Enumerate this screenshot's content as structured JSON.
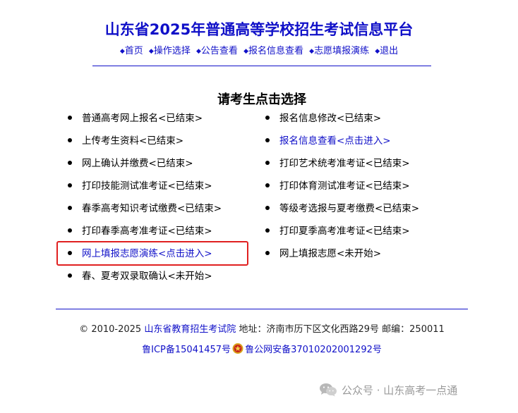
{
  "header": {
    "title": "山东省2025年普通高等学校招生考试信息平台",
    "nav": [
      {
        "label": "首页"
      },
      {
        "label": "操作选择"
      },
      {
        "label": "公告查看"
      },
      {
        "label": "报名信息查看"
      },
      {
        "label": "志愿填报演练"
      },
      {
        "label": "退出"
      }
    ]
  },
  "main": {
    "title": "请考生点击选择",
    "left_options": [
      {
        "label": "普通高考网上报名<已结束>"
      },
      {
        "label": "上传考生资料<已结束>"
      },
      {
        "label": "网上确认并缴费<已结束>"
      },
      {
        "label": "打印技能测试准考证<已结束>"
      },
      {
        "label": "春季高考知识考试缴费<已结束>"
      },
      {
        "label": "打印春季高考准考证<已结束>"
      },
      {
        "label": "网上填报志愿演练<点击进入>"
      },
      {
        "label": "春、夏考双录取确认<未开始>"
      }
    ],
    "right_options": [
      {
        "label": "报名信息修改<已结束>"
      },
      {
        "label": "报名信息查看<点击进入>"
      },
      {
        "label": "打印艺术统考准考证<已结束>"
      },
      {
        "label": "打印体育测试准考证<已结束>"
      },
      {
        "label": "等级考选报与夏考缴费<已结束>"
      },
      {
        "label": "打印夏季高考准考证<已结束>"
      },
      {
        "label": "网上填报志愿<未开始>"
      }
    ]
  },
  "footer": {
    "copyright": "© 2010-2025",
    "org_name": "山东省教育招生考试院",
    "address": "地址：济南市历下区文化西路29号 邮编：250011",
    "icp": "鲁ICP备15041457号",
    "police": "鲁公网安备37010202001292号"
  },
  "watermark": {
    "text": "公众号 · 山东高考一点通"
  },
  "colors": {
    "link_blue": "#1010c8",
    "highlight_red": "#e02020",
    "watermark_gray": "#9a9a9a"
  },
  "icons": {
    "nav_bullet": "diamond-icon",
    "police_badge": "police-badge-icon",
    "watermark": "wechat-icon"
  }
}
